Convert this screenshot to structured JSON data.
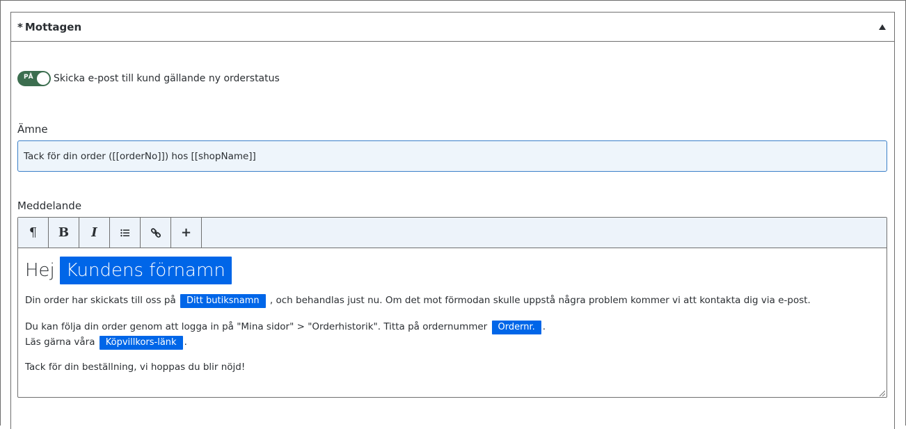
{
  "section": {
    "star": "*",
    "title": "Mottagen"
  },
  "toggle": {
    "state_label": "PÅ",
    "text": "Skicka e-post till kund gällande ny orderstatus"
  },
  "subject": {
    "label": "Ämne",
    "value": "Tack för din order ([[orderNo]]) hos [[shopName]]"
  },
  "message": {
    "label": "Meddelande",
    "toolbar": {
      "paragraph": "¶",
      "bold": "B",
      "italic": "I",
      "plus": "+"
    },
    "heading_word": "Hej",
    "heading_chip": "Kundens förnamn",
    "p1_before": "Din order har skickats till oss på",
    "p1_chip": "Ditt butiksnamn",
    "p1_after": ", och behandlas just nu. Om det mot förmodan skulle uppstå några problem kommer vi att kontakta dig via e-post.",
    "p2_line1_before": "Du kan följa din order genom att logga in på \"Mina sidor\" > \"Orderhistorik\". Titta på ordernummer",
    "p2_line1_chip": "Ordernr.",
    "p2_line1_after": ".",
    "p2_line2_before": "Läs gärna våra",
    "p2_line2_chip": "Köpvillkors-länk",
    "p2_line2_after": ".",
    "p3": "Tack för din beställning, vi hoppas du blir nöjd!"
  },
  "colors": {
    "toggle_on": "#3c6e4f",
    "chip": "#0066e8",
    "input_border": "#3a7fc8",
    "toolbar_bg": "#edf3fa"
  }
}
